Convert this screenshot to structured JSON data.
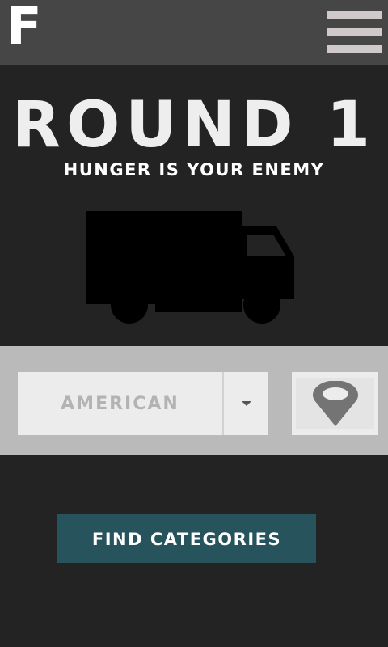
{
  "header": {
    "logo_text": "F",
    "menu_icon": "hamburger-menu-icon"
  },
  "main": {
    "title": "ROUND 1",
    "subtitle": "HUNGER IS YOUR ENEMY",
    "illustration_icon": "truck-icon"
  },
  "filters": {
    "cuisine_selected": "AMERICAN",
    "dropdown_icon": "chevron-down-icon",
    "location_icon": "location-pin-icon"
  },
  "actions": {
    "find_label": "FIND CATEGORIES"
  },
  "colors": {
    "background": "#232323",
    "header": "#464646",
    "panel": "#bababa",
    "button": "#26535c"
  }
}
